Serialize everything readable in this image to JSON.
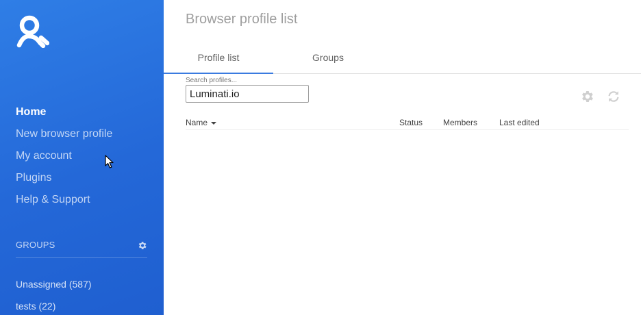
{
  "sidebar": {
    "logo_icon": "person-logo-icon",
    "nav": [
      {
        "label": "Home",
        "active": true
      },
      {
        "label": "New browser profile",
        "active": false
      },
      {
        "label": "My account",
        "active": false
      },
      {
        "label": "Plugins",
        "active": false
      },
      {
        "label": "Help & Support",
        "active": false
      }
    ],
    "groups_title": "GROUPS",
    "groups_icon": "gear-icon",
    "groups": [
      {
        "label": "Unassigned (587)"
      },
      {
        "label": "tests (22)"
      }
    ]
  },
  "main": {
    "title": "Browser profile list",
    "tabs": [
      {
        "label": "Profile list",
        "active": true
      },
      {
        "label": "Groups",
        "active": false
      }
    ],
    "search": {
      "label": "Search profiles...",
      "value": "Luminati.io"
    },
    "toolbar": {
      "settings_icon": "gear-icon",
      "refresh_icon": "sync-icon"
    },
    "table": {
      "columns": [
        "Name",
        "Status",
        "Members",
        "Last edited"
      ],
      "sort_column": "Name",
      "rows": []
    }
  },
  "colors": {
    "sidebar_bg": "#2468d8",
    "tab_indicator": "#3a7be0",
    "title_text": "#9e9e9e",
    "icon_gray": "#cfcfcf"
  }
}
